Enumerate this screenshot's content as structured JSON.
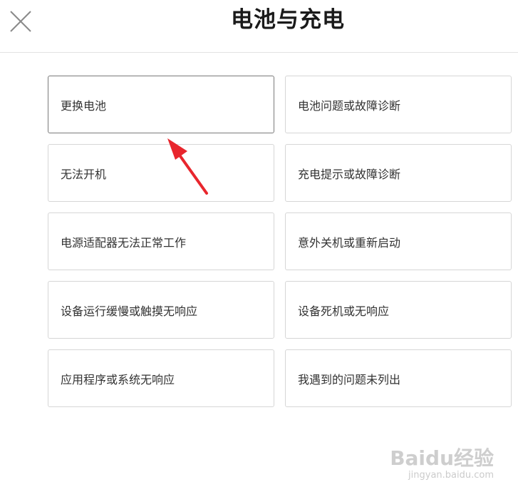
{
  "header": {
    "title": "电池与充电",
    "close_icon": "close-icon"
  },
  "options": [
    {
      "label": "更换电池",
      "selected": true
    },
    {
      "label": "电池问题或故障诊断",
      "selected": false
    },
    {
      "label": "无法开机",
      "selected": false
    },
    {
      "label": "充电提示或故障诊断",
      "selected": false
    },
    {
      "label": "电源适配器无法正常工作",
      "selected": false
    },
    {
      "label": "意外关机或重新启动",
      "selected": false
    },
    {
      "label": "设备运行缓慢或触摸无响应",
      "selected": false
    },
    {
      "label": "设备死机或无响应",
      "selected": false
    },
    {
      "label": "应用程序或系统无响应",
      "selected": false
    },
    {
      "label": "我遇到的问题未列出",
      "selected": false
    }
  ],
  "annotation": {
    "arrow_color": "#e8262d"
  },
  "watermark": {
    "brand": "Baidu经验",
    "url": "jingyan.baidu.com"
  },
  "colors": {
    "border": "#d6d6d6",
    "selected_border": "#7a7a7a",
    "text": "#333333"
  }
}
